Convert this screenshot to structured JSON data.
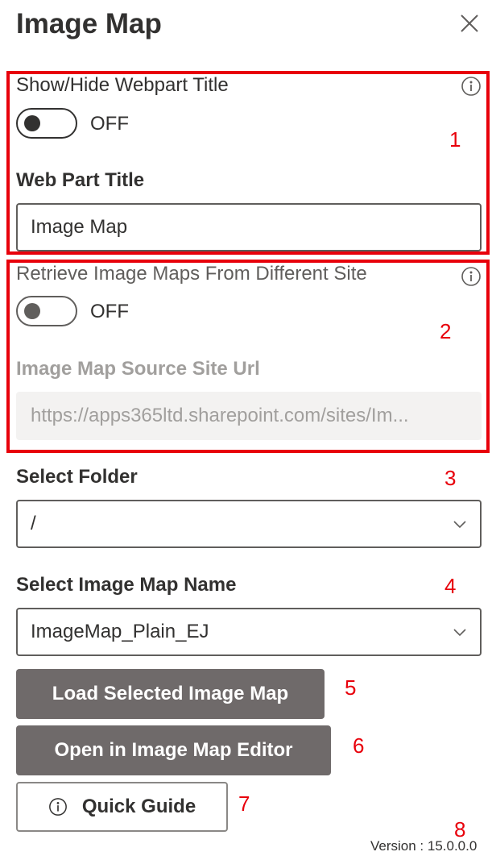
{
  "panel": {
    "title": "Image Map"
  },
  "section1": {
    "show_title_label": "Show/Hide Webpart Title",
    "toggle_state": "OFF",
    "web_part_title_label": "Web Part Title",
    "web_part_title_value": "Image Map",
    "marker": "1"
  },
  "section2": {
    "retrieve_label": "Retrieve Image Maps From Different Site",
    "toggle_state": "OFF",
    "source_url_label": "Image Map Source Site Url",
    "source_url_value": "https://apps365ltd.sharepoint.com/sites/Im...",
    "marker": "2"
  },
  "folder": {
    "label": "Select Folder",
    "value": "/",
    "marker": "3"
  },
  "image_map": {
    "label": "Select Image Map Name",
    "value": "ImageMap_Plain_EJ",
    "marker": "4"
  },
  "buttons": {
    "load_label": "Load Selected Image Map",
    "load_marker": "5",
    "open_label": "Open in Image Map Editor",
    "open_marker": "6",
    "guide_label": "Quick Guide",
    "guide_marker": "7"
  },
  "footer": {
    "marker": "8",
    "version": "Version : 15.0.0.0"
  },
  "colors": {
    "highlight": "#e8000b",
    "button_dark": "#6f6a6a",
    "text": "#323130"
  }
}
